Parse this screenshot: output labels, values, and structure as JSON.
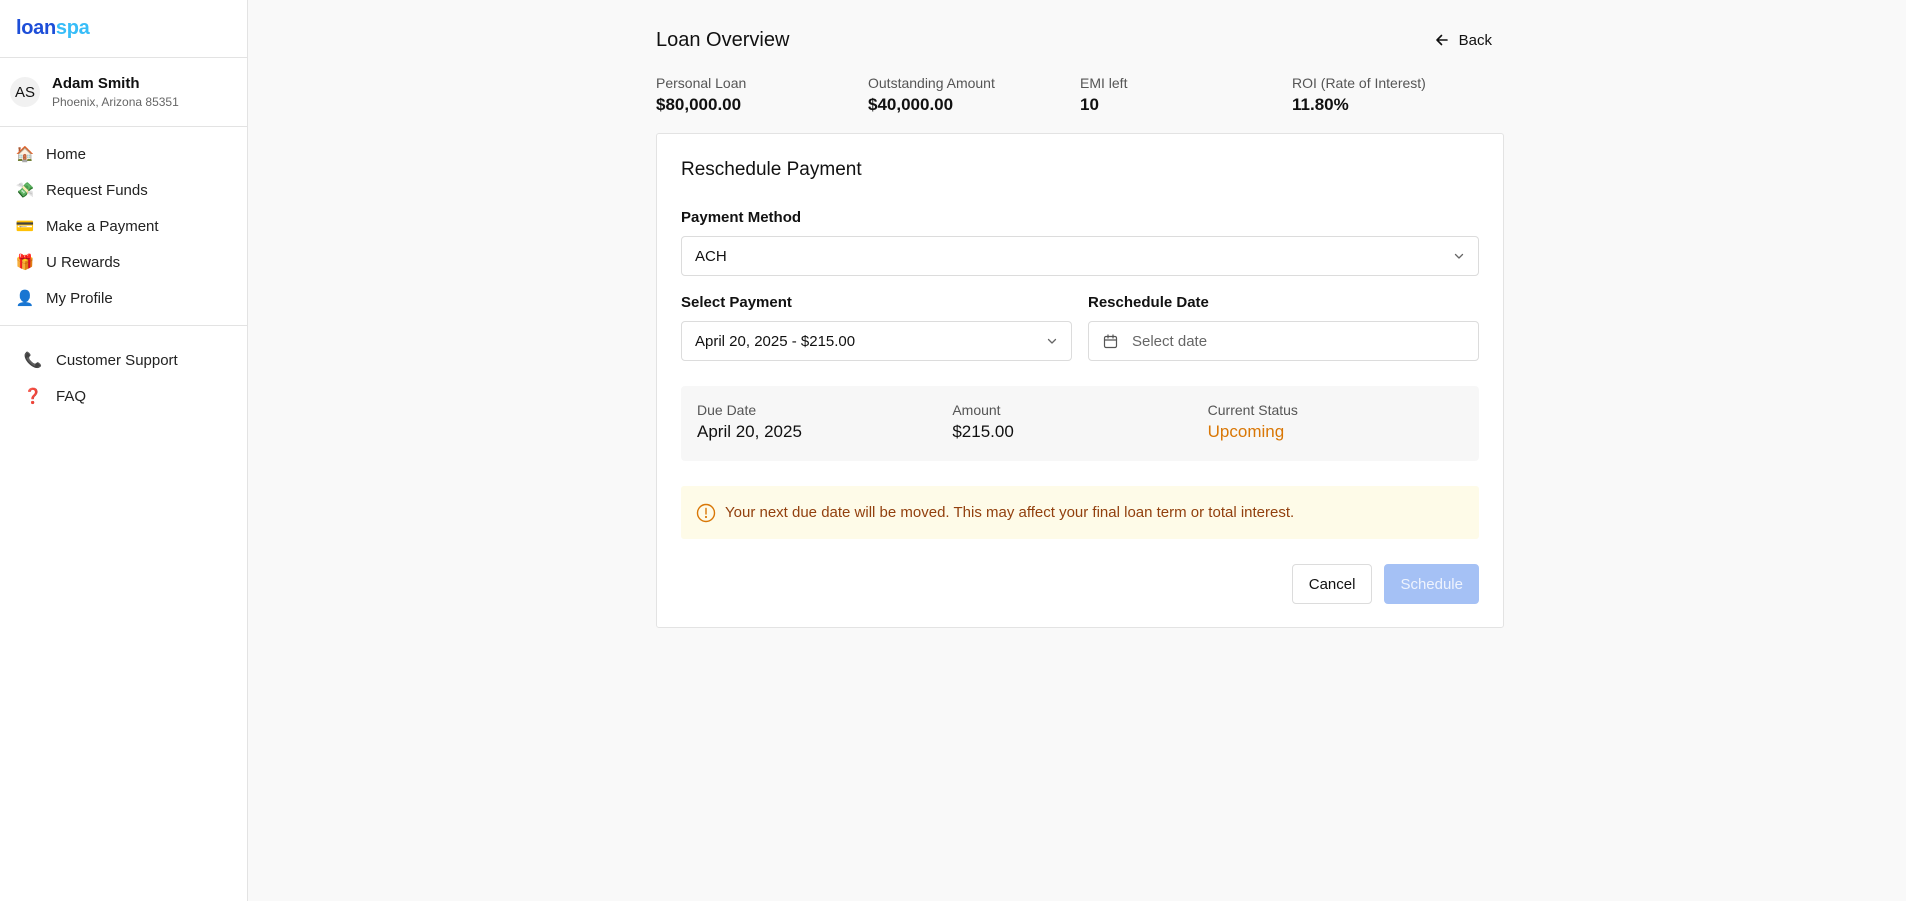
{
  "brand": {
    "part1": "loan",
    "part2": "spa"
  },
  "user": {
    "initials": "AS",
    "name": "Adam Smith",
    "location": "Phoenix, Arizona 85351"
  },
  "nav": {
    "items": [
      {
        "label": "Home",
        "icon": "house-icon",
        "glyph": "🏠"
      },
      {
        "label": "Request Funds",
        "icon": "money-icon",
        "glyph": "💸"
      },
      {
        "label": "Make a Payment",
        "icon": "credit-card-icon",
        "glyph": "💳"
      },
      {
        "label": "U Rewards",
        "icon": "gift-icon",
        "glyph": "🎁"
      },
      {
        "label": "My Profile",
        "icon": "user-icon",
        "glyph": "👤"
      }
    ],
    "secondary": [
      {
        "label": "Customer Support",
        "icon": "phone-icon",
        "glyph": "📞"
      },
      {
        "label": "FAQ",
        "icon": "question-icon",
        "glyph": "❓"
      }
    ]
  },
  "header": {
    "title": "Loan Overview",
    "back_label": "Back"
  },
  "stats": [
    {
      "label": "Personal Loan",
      "value": "$80,000.00"
    },
    {
      "label": "Outstanding Amount",
      "value": "$40,000.00"
    },
    {
      "label": "EMI left",
      "value": "10"
    },
    {
      "label": "ROI (Rate of Interest)",
      "value": "11.80%"
    }
  ],
  "form": {
    "title": "Reschedule Payment",
    "payment_method_label": "Payment Method",
    "payment_method_value": "ACH",
    "select_payment_label": "Select Payment",
    "select_payment_value": "April 20, 2025 - $215.00",
    "reschedule_date_label": "Reschedule Date",
    "reschedule_date_placeholder": "Select date"
  },
  "summary": {
    "due_date_label": "Due Date",
    "due_date_value": "April 20, 2025",
    "amount_label": "Amount",
    "amount_value": "$215.00",
    "status_label": "Current Status",
    "status_value": "Upcoming"
  },
  "alert": {
    "text": "Your next due date will be moved. This may affect your final loan term or total interest."
  },
  "actions": {
    "cancel_label": "Cancel",
    "schedule_label": "Schedule"
  },
  "colors": {
    "accent": "#1d4ed8",
    "status_upcoming": "#d97706",
    "alert_bg": "#fefbe8",
    "schedule_disabled": "#a5c1f5"
  }
}
